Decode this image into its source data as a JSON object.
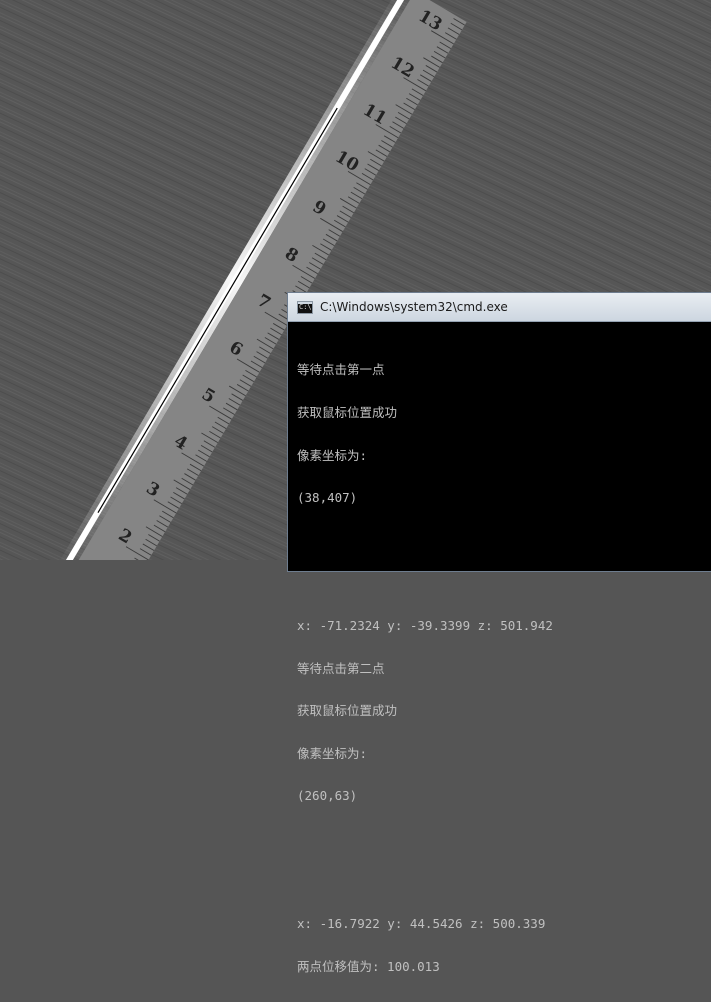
{
  "ruler": {
    "tick_numbers": [
      "2",
      "3",
      "4",
      "5",
      "6",
      "7",
      "8",
      "9",
      "10",
      "11",
      "12",
      "13"
    ]
  },
  "console": {
    "title": "C:\\Windows\\system32\\cmd.exe",
    "lines": [
      "等待点击第一点",
      "获取鼠标位置成功",
      "像素坐标为:",
      "(38,407)",
      "",
      "",
      "x: -71.2324 y: -39.3399 z: 501.942",
      "等待点击第二点",
      "获取鼠标位置成功",
      "像素坐标为:",
      "(260,63)",
      "",
      "",
      "x: -16.7922 y: 44.5426 z: 500.339",
      "两点位移值为: 100.013"
    ]
  },
  "colors": {
    "background": "#555555",
    "ruler": "#8a8a8a",
    "console_bg": "#000000",
    "console_text": "#c0c0c0"
  }
}
